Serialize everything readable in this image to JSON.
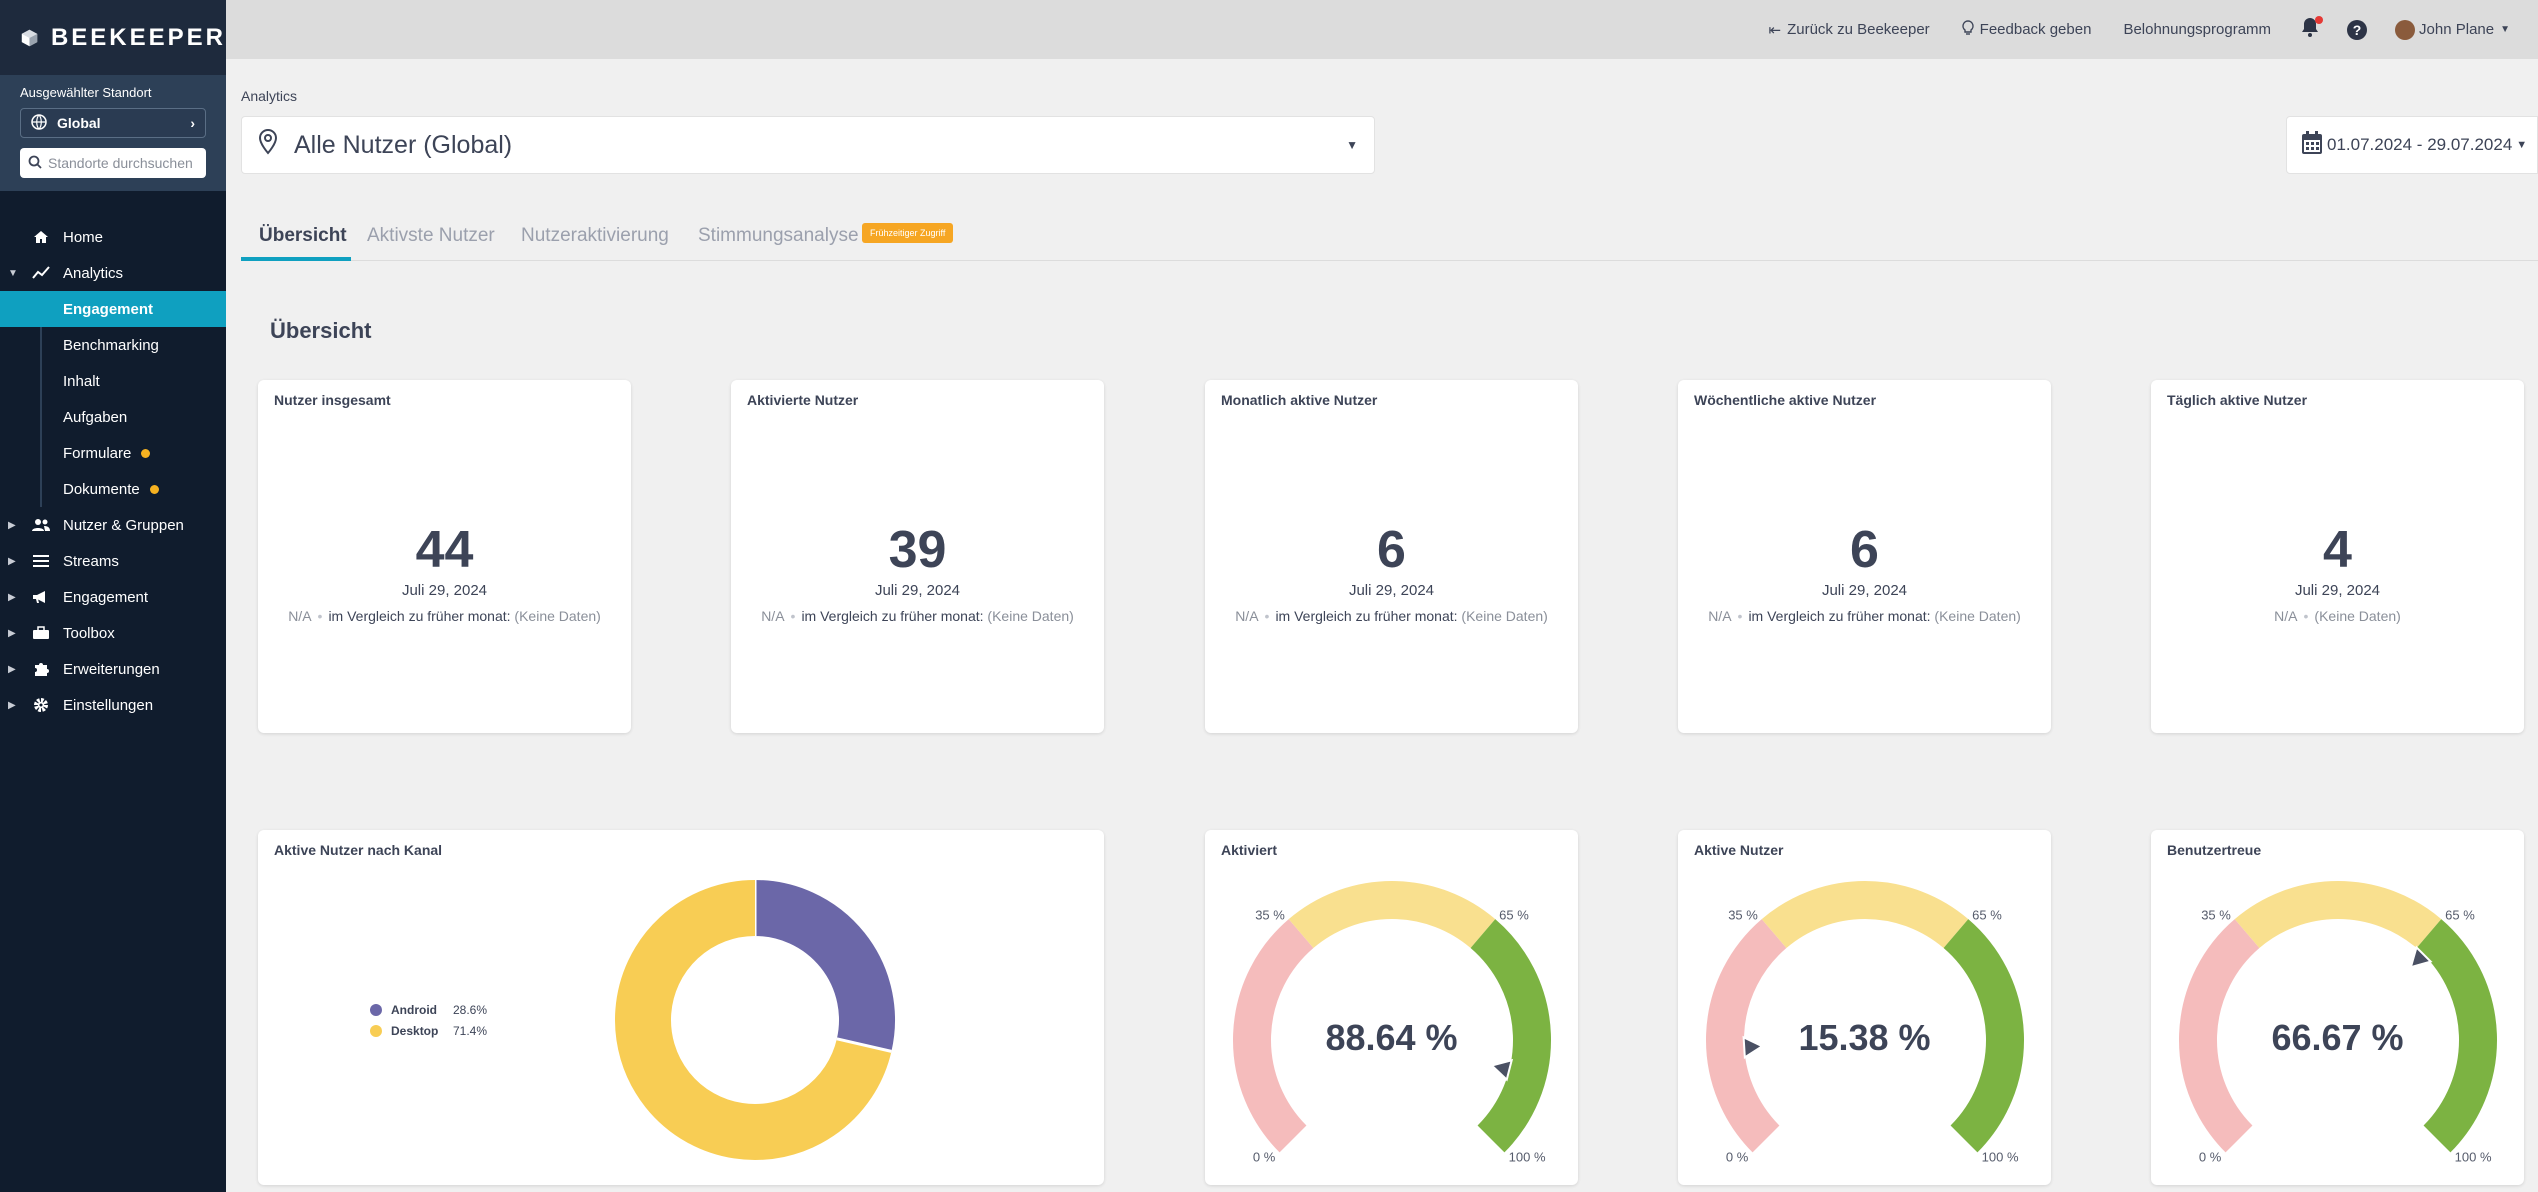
{
  "app": {
    "logo_text": "BEEKEEPER"
  },
  "location": {
    "label": "Ausgewählter Standort",
    "selected": "Global",
    "search_placeholder": "Standorte durchsuchen"
  },
  "nav": {
    "home": "Home",
    "analytics": "Analytics",
    "sub": {
      "engagement": "Engagement",
      "benchmarking": "Benchmarking",
      "inhalt": "Inhalt",
      "aufgaben": "Aufgaben",
      "formulare": "Formulare",
      "dokumente": "Dokumente"
    },
    "nutzer_gruppen": "Nutzer & Gruppen",
    "streams": "Streams",
    "engagement": "Engagement",
    "toolbox": "Toolbox",
    "erweiterungen": "Erweiterungen",
    "einstellungen": "Einstellungen"
  },
  "topbar": {
    "back": "Zurück zu Beekeeper",
    "feedback": "Feedback geben",
    "rewards": "Belohnungsprogramm",
    "user": "John Plane"
  },
  "breadcrumb": "Analytics",
  "user_selector": "Alle Nutzer (Global)",
  "date_range": "01.07.2024 - 29.07.2024",
  "tabs": {
    "overview": "Übersicht",
    "active_users": "Aktivste Nutzer",
    "activation": "Nutzeraktivierung",
    "sentiment": "Stimmungsanalyse",
    "early_access": "Frühzeitiger Zugriff"
  },
  "section_title": "Übersicht",
  "stats": [
    {
      "title": "Nutzer insgesamt",
      "value": "44",
      "date": "Juli 29, 2024",
      "na": "N/A",
      "compare": "im Vergleich zu früher monat:",
      "nodata": "(Keine Daten)"
    },
    {
      "title": "Aktivierte Nutzer",
      "value": "39",
      "date": "Juli 29, 2024",
      "na": "N/A",
      "compare": "im Vergleich zu früher monat:",
      "nodata": "(Keine Daten)"
    },
    {
      "title": "Monatlich aktive Nutzer",
      "value": "6",
      "date": "Juli 29, 2024",
      "na": "N/A",
      "compare": "im Vergleich zu früher monat:",
      "nodata": "(Keine Daten)"
    },
    {
      "title": "Wöchentliche aktive Nutzer",
      "value": "6",
      "date": "Juli 29, 2024",
      "na": "N/A",
      "compare": "im Vergleich zu früher monat:",
      "nodata": "(Keine Daten)"
    },
    {
      "title": "Täglich aktive Nutzer",
      "value": "4",
      "date": "Juli 29, 2024",
      "na": "N/A",
      "compare": "",
      "nodata": "(Keine Daten)"
    }
  ],
  "channels": {
    "title": "Aktive Nutzer nach Kanal",
    "items": [
      {
        "name": "Android",
        "pct_label": "28.6%",
        "value": 28.6,
        "color": "#6b67a8"
      },
      {
        "name": "Desktop",
        "pct_label": "71.4%",
        "value": 71.4,
        "color": "#f8cd54"
      }
    ]
  },
  "gauges": [
    {
      "title": "Aktiviert",
      "value": 88.64,
      "label": "88.64 %"
    },
    {
      "title": "Aktive Nutzer",
      "value": 15.38,
      "label": "15.38 %"
    },
    {
      "title": "Benutzertreue",
      "value": 66.67,
      "label": "66.67 %"
    }
  ],
  "gauge_ticks": {
    "t0": "0 %",
    "t35": "35 %",
    "t65": "65 %",
    "t100": "100 %"
  },
  "colors": {
    "accent": "#0fa0c0",
    "sidebar": "#101c2d",
    "gauge_low": "#f5bcbc",
    "gauge_mid": "#f9e08f",
    "gauge_high": "#7cb342",
    "badge": "#f6a623"
  }
}
